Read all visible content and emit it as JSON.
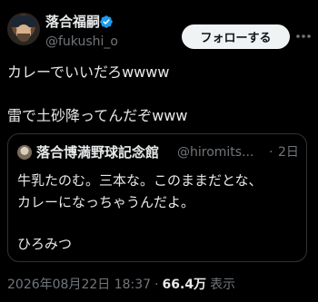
{
  "author": {
    "display_name": "落合福嗣",
    "handle": "@fukushi_o",
    "verified": true
  },
  "actions": {
    "follow_label": "フォローする"
  },
  "tweet": {
    "lines": [
      "カレーでいいだろwwww",
      "雷で土砂降ってんだぞwww"
    ]
  },
  "quote": {
    "display_name": "落合博満野球記念館",
    "handle": "@hiromits...",
    "separator": "·",
    "time": "2日",
    "lines": [
      "牛乳たのむ。三本な。このままだとな、",
      "カレーになっちゃうんだよ。",
      "ひろみつ"
    ]
  },
  "meta": {
    "timestamp": "2026年08月22日 18:37",
    "separator": "·",
    "views": "66.4万",
    "views_label": "表示"
  },
  "colors": {
    "background": "#000000",
    "text": "#e7e9ea",
    "muted": "#71767b",
    "verified_blue": "#1d9bf0",
    "border": "#2f3336"
  }
}
